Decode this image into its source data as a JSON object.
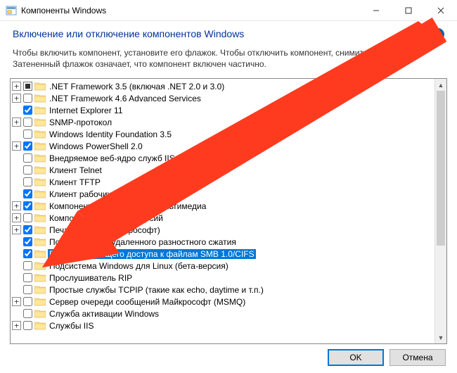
{
  "window": {
    "title": "Компоненты Windows",
    "minimize": "—",
    "maximize": "☐",
    "close": "✕"
  },
  "header": {
    "instruction": "Включение или отключение компонентов Windows",
    "help": "?"
  },
  "sub": "Чтобы включить компонент, установите его флажок. Чтобы отключить компонент, снимите его флажок. Затененный флажок означает, что компонент включен частично.",
  "buttons": {
    "ok": "OK",
    "cancel": "Отмена"
  },
  "tree": [
    {
      "exp": "+",
      "state": "tri",
      "label": ".NET Framework 3.5 (включая .NET 2.0 и 3.0)"
    },
    {
      "exp": "+",
      "state": "unchecked",
      "label": ".NET Framework 4.6 Advanced Services"
    },
    {
      "exp": "",
      "state": "checked",
      "label": "Internet Explorer 11"
    },
    {
      "exp": "+",
      "state": "unchecked",
      "label": "SNMP-протокол"
    },
    {
      "exp": "",
      "state": "unchecked",
      "label": "Windows Identity Foundation 3.5"
    },
    {
      "exp": "+",
      "state": "checked",
      "label": "Windows PowerShell 2.0"
    },
    {
      "exp": "",
      "state": "unchecked",
      "label": "Внедряемое веб-ядро служб IIS"
    },
    {
      "exp": "",
      "state": "unchecked",
      "label": "Клиент Telnet"
    },
    {
      "exp": "",
      "state": "unchecked",
      "label": "Клиент TFTP"
    },
    {
      "exp": "",
      "state": "checked",
      "label": "Клиент рабочих папок"
    },
    {
      "exp": "+",
      "state": "checked",
      "label": "Компоненты для работы с мультимедиа"
    },
    {
      "exp": "+",
      "state": "unchecked",
      "label": "Компоненты прежних версий"
    },
    {
      "exp": "+",
      "state": "checked",
      "label": "Печать в PDF (Майкрософт)"
    },
    {
      "exp": "",
      "state": "checked",
      "label": "Поддержка API удаленного разностного сжатия"
    },
    {
      "exp": "",
      "state": "checked",
      "label": "Поддержка общего доступа к файлам SMB 1.0/CIFS",
      "selected": true
    },
    {
      "exp": "",
      "state": "unchecked",
      "label": "Подсистема Windows для Linux (бета-версия)"
    },
    {
      "exp": "",
      "state": "unchecked",
      "label": "Прослушиватель RIP"
    },
    {
      "exp": "",
      "state": "unchecked",
      "label": "Простые службы TCPIP (такие как echo, daytime и т.п.)"
    },
    {
      "exp": "+",
      "state": "unchecked",
      "label": "Сервер очереди сообщений Майкрософт (MSMQ)"
    },
    {
      "exp": "",
      "state": "unchecked",
      "label": "Служба активации Windows"
    },
    {
      "exp": "+",
      "state": "unchecked",
      "label": "Службы IIS"
    }
  ]
}
